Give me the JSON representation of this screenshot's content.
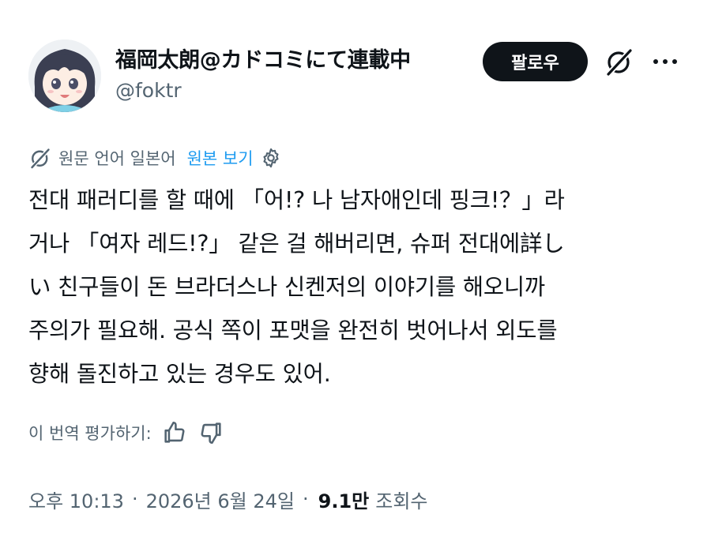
{
  "author": {
    "display_name": "福岡太朗@カドコミにて連載中",
    "handle": "@foktr",
    "avatar": "anime-girl-avatar"
  },
  "header": {
    "follow_label": "팔로우",
    "grok_icon": "grok-icon",
    "more_icon": "more-icon"
  },
  "translation": {
    "notice": "원문 언어 일본어",
    "show_original": "원본 보기",
    "settings_icon": "gear-icon"
  },
  "post": {
    "lines": [
      "전대 패러디를 할 때에 「어!? 나 남자애인데 핑크!？」라",
      "거나 「여자 레드!?」 같은 걸 해버리면, 슈퍼 전대에詳し",
      "い 친구들이 돈 브라더스나 신켄저의 이야기를 해오니까",
      "주의가 필요해. 공식 쪽이 포맷을 완전히 벗어나서 외도를",
      "향해 돌진하고 있는 경우도 있어."
    ]
  },
  "rating": {
    "label": "이 번역 평가하기:",
    "like_icon": "thumbs-up-icon",
    "dislike_icon": "thumbs-down-icon"
  },
  "meta": {
    "time": "오후 10:13",
    "separator": "·",
    "date": "2026년 6월 24일",
    "views_count": "9.1만",
    "views_label": "조회수"
  },
  "colors": {
    "text": "#0f1419",
    "secondary": "#536471",
    "link": "#1d9bf0",
    "button_bg": "#0f1419"
  }
}
